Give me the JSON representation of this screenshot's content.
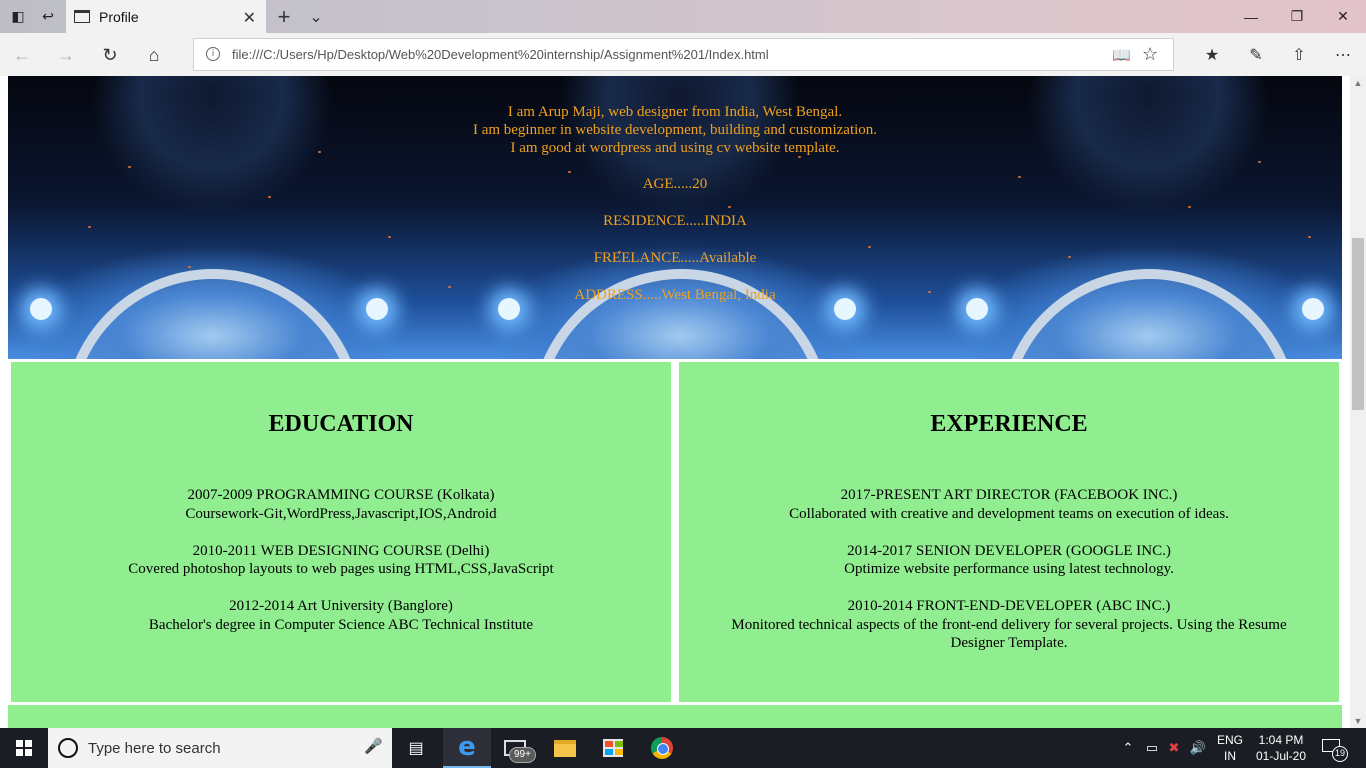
{
  "browser": {
    "tab_title": "Profile",
    "url": "file:///C:/Users/Hp/Desktop/Web%20Development%20internship/Assignment%201/Index.html"
  },
  "hero": {
    "intro": [
      "I am Arup Maji, web designer from India, West Bengal.",
      "I am beginner in website development, building and customization.",
      "I am good at wordpress and using cv website template."
    ],
    "age": "AGE.....20",
    "residence": "RESIDENCE.....INDIA",
    "freelance": "FREELANCE.....Available",
    "address": "ADDRESS.....West Bengal, India",
    "text_color": "#f0a01e"
  },
  "education": {
    "heading": "EDUCATION",
    "items": [
      {
        "title": "2007-2009 PROGRAMMING COURSE (Kolkata)",
        "desc": "Coursework-Git,WordPress,Javascript,IOS,Android"
      },
      {
        "title": "2010-2011 WEB DESIGNING COURSE (Delhi)",
        "desc": "Covered photoshop layouts to web pages using HTML,CSS,JavaScript"
      },
      {
        "title": "2012-2014 Art University (Banglore)",
        "desc": "Bachelor's degree in Computer Science ABC Technical Institute"
      }
    ]
  },
  "experience": {
    "heading": "EXPERIENCE",
    "items": [
      {
        "title": "2017-PRESENT ART DIRECTOR (FACEBOOK INC.)",
        "desc": "Collaborated with creative and development teams on execution of ideas."
      },
      {
        "title": "2014-2017 SENION DEVELOPER (GOOGLE INC.)",
        "desc": "Optimize website performance using latest technology."
      },
      {
        "title": "2010-2014 FRONT-END-DEVELOPER (ABC INC.)",
        "desc": "Monitored technical aspects of the front-end delivery for several projects. Using the Resume Designer Template."
      }
    ]
  },
  "panel_color": "#90ee90",
  "taskbar": {
    "search_placeholder": "Type here to search",
    "mail_badge": "99+",
    "lang_top": "ENG",
    "lang_bottom": "IN",
    "time": "1:04 PM",
    "date": "01-Jul-20",
    "notifications": "19"
  },
  "icons": {
    "taskbar_apps": [
      "edge-icon",
      "mail-icon",
      "file-explorer-icon",
      "store-icon",
      "chrome-icon"
    ],
    "tray": [
      "chevron-up-icon",
      "battery-icon",
      "network-icon",
      "volume-icon",
      "notification-icon"
    ]
  }
}
